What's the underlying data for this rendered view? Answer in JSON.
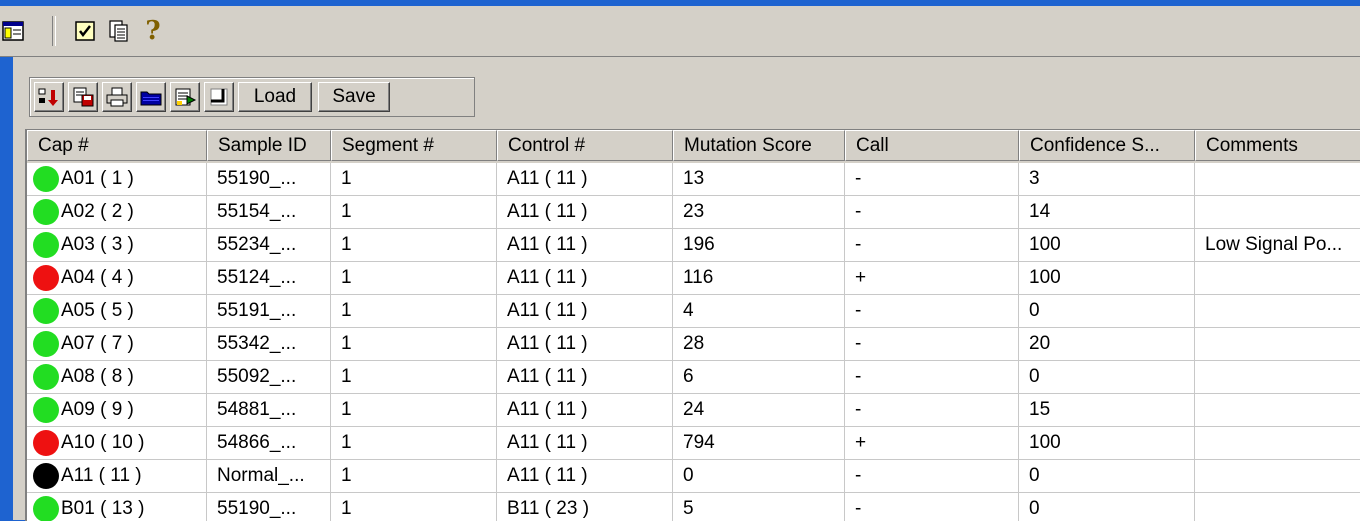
{
  "main_toolbar": {
    "icons": [
      "table-window-icon",
      "checklist-icon",
      "copy-pages-icon",
      "help-icon"
    ],
    "help_glyph": "?"
  },
  "sub_toolbar": {
    "icons": [
      "import-arrow-icon",
      "save-report-icon",
      "print-icon",
      "folder-icon",
      "export-sheet-icon",
      "corner-icon"
    ],
    "load_label": "Load",
    "save_label": "Save"
  },
  "colors": {
    "pass": "#22dd22",
    "fail": "#ee1111",
    "control": "#000000"
  },
  "table": {
    "columns": [
      "Cap #",
      "Sample ID",
      "Segment #",
      "Control #",
      "Mutation Score",
      "Call",
      "Confidence S...",
      "Comments"
    ],
    "rows": [
      {
        "status": "pass",
        "cap": "A01 ( 1 )",
        "sample": "55190_...",
        "segment": "1",
        "control": "A11 ( 11 )",
        "score": "13",
        "call": "-",
        "confidence": "3",
        "comments": ""
      },
      {
        "status": "pass",
        "cap": "A02 ( 2 )",
        "sample": "55154_...",
        "segment": "1",
        "control": "A11 ( 11 )",
        "score": "23",
        "call": "-",
        "confidence": "14",
        "comments": ""
      },
      {
        "status": "pass",
        "cap": "A03 ( 3 )",
        "sample": "55234_...",
        "segment": "1",
        "control": "A11 ( 11 )",
        "score": "196",
        "call": "-",
        "confidence": "100",
        "comments": "Low Signal Po..."
      },
      {
        "status": "fail",
        "cap": "A04 ( 4 )",
        "sample": "55124_...",
        "segment": "1",
        "control": "A11 ( 11 )",
        "score": "116",
        "call": "+",
        "confidence": "100",
        "comments": ""
      },
      {
        "status": "pass",
        "cap": "A05 ( 5 )",
        "sample": "55191_...",
        "segment": "1",
        "control": "A11 ( 11 )",
        "score": "4",
        "call": "-",
        "confidence": "0",
        "comments": ""
      },
      {
        "status": "pass",
        "cap": "A07 ( 7 )",
        "sample": "55342_...",
        "segment": "1",
        "control": "A11 ( 11 )",
        "score": "28",
        "call": "-",
        "confidence": "20",
        "comments": ""
      },
      {
        "status": "pass",
        "cap": "A08 ( 8 )",
        "sample": "55092_...",
        "segment": "1",
        "control": "A11 ( 11 )",
        "score": "6",
        "call": "-",
        "confidence": "0",
        "comments": ""
      },
      {
        "status": "pass",
        "cap": "A09 ( 9 )",
        "sample": "54881_...",
        "segment": "1",
        "control": "A11 ( 11 )",
        "score": "24",
        "call": "-",
        "confidence": "15",
        "comments": ""
      },
      {
        "status": "fail",
        "cap": "A10 ( 10 )",
        "sample": "54866_...",
        "segment": "1",
        "control": "A11 ( 11 )",
        "score": "794",
        "call": "+",
        "confidence": "100",
        "comments": ""
      },
      {
        "status": "control",
        "cap": "A11 ( 11 )",
        "sample": "Normal_...",
        "segment": "1",
        "control": "A11 ( 11 )",
        "score": "0",
        "call": "-",
        "confidence": "0",
        "comments": ""
      },
      {
        "status": "pass",
        "cap": "B01 ( 13 )",
        "sample": "55190_...",
        "segment": "1",
        "control": "B11 ( 23 )",
        "score": "5",
        "call": "-",
        "confidence": "0",
        "comments": ""
      }
    ]
  }
}
